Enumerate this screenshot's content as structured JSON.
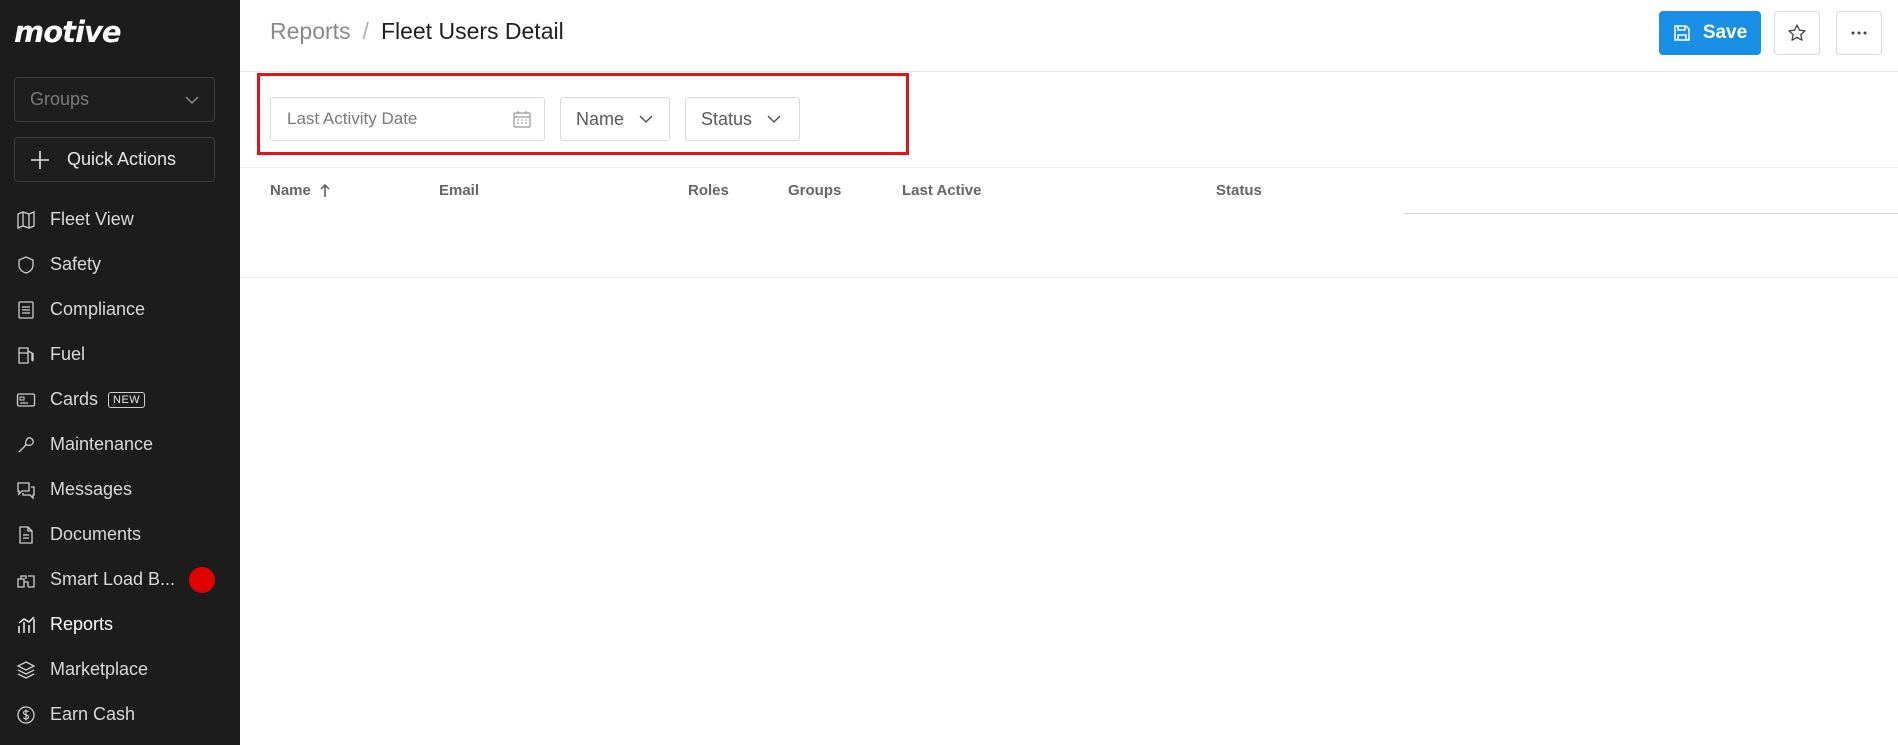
{
  "app": {
    "logo": "motive"
  },
  "sidebar": {
    "groups_placeholder": "Groups",
    "quick_actions_label": "Quick Actions",
    "items": [
      {
        "label": "Fleet View",
        "icon": "map-icon"
      },
      {
        "label": "Safety",
        "icon": "shield-icon"
      },
      {
        "label": "Compliance",
        "icon": "document-list-icon"
      },
      {
        "label": "Fuel",
        "icon": "fuel-pump-icon"
      },
      {
        "label": "Cards",
        "icon": "card-icon",
        "badge": "NEW"
      },
      {
        "label": "Maintenance",
        "icon": "wrench-icon"
      },
      {
        "label": "Messages",
        "icon": "chat-icon"
      },
      {
        "label": "Documents",
        "icon": "file-icon"
      },
      {
        "label": "Smart Load B...",
        "icon": "truck-load-icon",
        "notification": true
      },
      {
        "label": "Reports",
        "icon": "chart-icon",
        "active": true
      },
      {
        "label": "Marketplace",
        "icon": "layers-icon"
      },
      {
        "label": "Earn Cash",
        "icon": "dollar-coin-icon"
      }
    ]
  },
  "header": {
    "breadcrumb_parent": "Reports",
    "breadcrumb_separator": "/",
    "title": "Fleet Users Detail",
    "save_label": "Save"
  },
  "filters": {
    "date_placeholder": "Last Activity Date",
    "name_label": "Name",
    "status_label": "Status"
  },
  "table": {
    "columns": [
      "Name",
      "Email",
      "Roles",
      "Groups",
      "Last Active",
      "Status"
    ],
    "sort_column": "Name",
    "sort_direction": "ascending"
  },
  "colors": {
    "sidebar_bg": "#1c1c1c",
    "primary": "#1a8fe6",
    "highlight": "#e0151a",
    "notification": "#e00000"
  }
}
